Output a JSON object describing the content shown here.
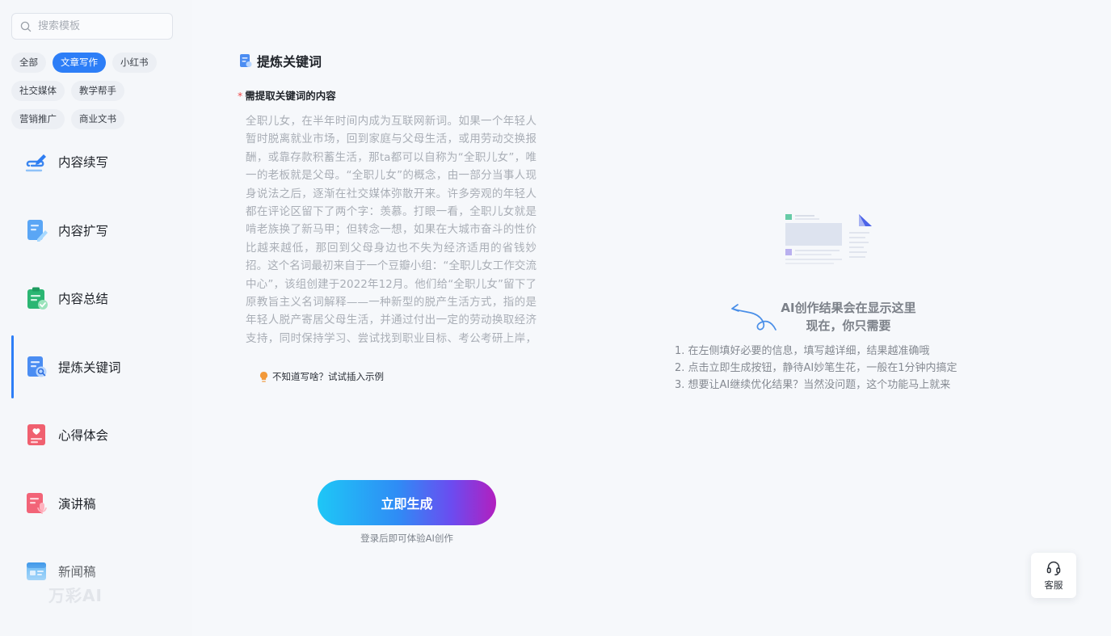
{
  "search": {
    "placeholder": "搜索模板"
  },
  "tags": [
    {
      "label": "全部"
    },
    {
      "label": "文章写作"
    },
    {
      "label": "小红书"
    },
    {
      "label": "社交媒体"
    },
    {
      "label": "教学帮手"
    },
    {
      "label": "营销推广"
    },
    {
      "label": "商业文书"
    }
  ],
  "nav": [
    {
      "label": "内容续写",
      "icon": "pen-cloud-icon"
    },
    {
      "label": "内容扩写",
      "icon": "edit-document-icon"
    },
    {
      "label": "内容总结",
      "icon": "clipboard-check-icon"
    },
    {
      "label": "提炼关键词",
      "icon": "document-search-icon"
    },
    {
      "label": "心得体会",
      "icon": "heart-note-icon"
    },
    {
      "label": "演讲稿",
      "icon": "microphone-note-icon"
    },
    {
      "label": "新闻稿",
      "icon": "newspaper-icon"
    }
  ],
  "brand": {
    "logo_text": "万彩AI"
  },
  "form": {
    "title": "提炼关键词",
    "field_label": "需提取关键词的内容",
    "content_text": "全职儿女，在半年时间内成为互联网新词。如果一个年轻人暂时脱离就业市场，回到家庭与父母生活，或用劳动交换报酬，或靠存款积蓄生活，那ta都可以自称为“全职儿女”，唯一的老板就是父母。“全职儿女”的概念，由一部分当事人现身说法之后，逐渐在社交媒体弥散开来。许多旁观的年轻人都在评论区留下了两个字：羡慕。打眼一看，全职儿女就是啃老族换了新马甲；但转念一想，如果在大城市奋斗的性价比越来越低，那回到父母身边也不失为经济适用的省钱妙招。这个名词最初来自于一个豆瓣小组：“全职儿女工作交流中心”，该组创建于2022年12月。他们给“全职儿女”留下了原教旨主义名词解释——一种新型的脱产生活方式，指的是年轻人脱产寄居父母生活，并通过付出一定的劳动换取经济支持，同时保持学习、尝试找到职业目标、考公考研上岸，小组目前聚集了",
    "hint": "不知道写啥？试试插入示例",
    "generate_label": "立即生成",
    "login_tip": "登录后即可体验AI创作"
  },
  "result": {
    "title_line1": "AI创作结果会在显示这里",
    "title_line2": "现在，你只需要",
    "steps": [
      "1. 在左侧填好必要的信息，填写越详细，结果越准确哦",
      "2. 点击立即生成按钮，静待AI妙笔生花，一般在1分钟内搞定",
      "3. 想要让AI继续优化结果？当然没问题，这个功能马上就来"
    ]
  },
  "service": {
    "label": "客服"
  },
  "colors": {
    "accent": "#2d7ef7",
    "required": "#f04848",
    "button_gradient_start": "#1ec7f6",
    "button_gradient_end": "#b21fbf"
  }
}
